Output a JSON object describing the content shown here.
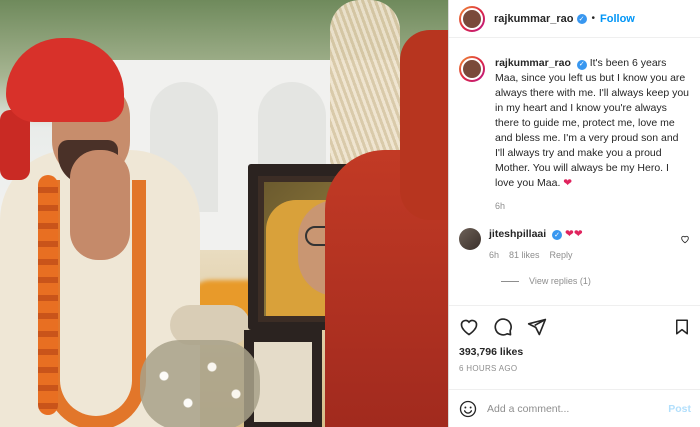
{
  "header": {
    "username": "rajkummar_rao",
    "separator": "•",
    "follow_label": "Follow"
  },
  "caption": {
    "username": "rajkummar_rao",
    "text": "It's been 6 years Maa, since you left us but I know you are always there with me. I'll always keep you in my heart and I know you're always there to guide me, protect me, love me and bless me. I'm a very proud son and I'll always try and make you a proud Mother. You will always be my Hero. I love you Maa.",
    "emoji": "❤",
    "time": "6h"
  },
  "comment": {
    "username": "jiteshpillaai",
    "emoji": "❤❤",
    "time": "6h",
    "likes": "81 likes",
    "reply_label": "Reply",
    "view_replies": "View replies (1)"
  },
  "actions": {
    "likes_count": "393,796 likes",
    "time_ago": "6 HOURS AGO"
  },
  "add_comment": {
    "placeholder": "Add a comment...",
    "post_label": "Post"
  },
  "colors": {
    "link_blue": "#0095f6",
    "verified_blue": "#3897f0",
    "post_disabled": "#b2dffc",
    "heart_red": "#e0245e"
  }
}
